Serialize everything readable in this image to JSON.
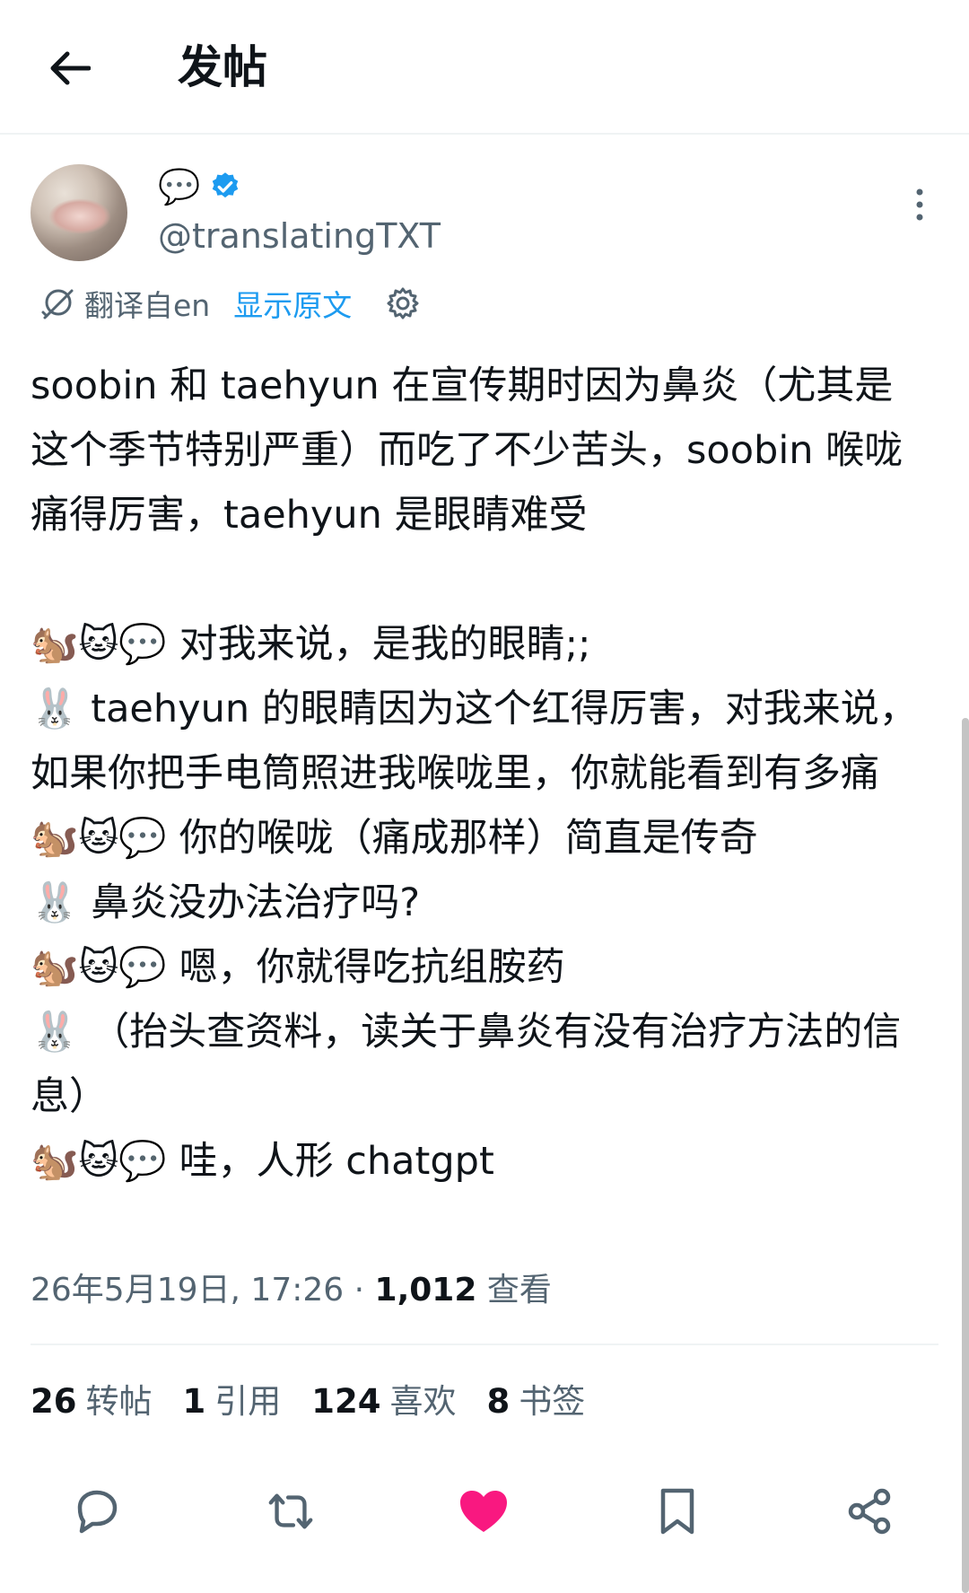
{
  "header": {
    "title": "发帖"
  },
  "author": {
    "name_icon": "speech-balloon",
    "handle": "@translatingTXT",
    "verified_color": "#1d9bf0"
  },
  "translation": {
    "translated_from": "翻译自en",
    "show_original": "显示原文"
  },
  "tweet": {
    "text": "soobin 和 taehyun 在宣传期时因为鼻炎（尤其是这个季节特别严重）而吃了不少苦头，soobin 喉咙痛得厉害，taehyun 是眼睛难受\n\n🐿️🐱💬 对我来说，是我的眼睛;;\n🐰 taehyun 的眼睛因为这个红得厉害，对我来说，如果你把手电筒照进我喉咙里，你就能看到有多痛\n🐿️🐱💬 你的喉咙（痛成那样）简直是传奇\n🐰 鼻炎没办法治疗吗?\n🐿️🐱💬 嗯，你就得吃抗组胺药\n🐰 （抬头查资料，读关于鼻炎有没有治疗方法的信息）\n🐿️🐱💬 哇，人形 chatgpt",
    "timestamp": "26年5月19日, 17:26",
    "separator": "·",
    "views_count": "1,012",
    "views_label": "查看"
  },
  "stats": {
    "retweets_count": "26",
    "retweets_label": "转帖",
    "quotes_count": "1",
    "quotes_label": "引用",
    "likes_count": "124",
    "likes_label": "喜欢",
    "bookmarks_count": "8",
    "bookmarks_label": "书签"
  },
  "colors": {
    "text_primary": "#0f1419",
    "text_secondary": "#536471",
    "accent": "#1d9bf0",
    "like": "#f91880"
  }
}
